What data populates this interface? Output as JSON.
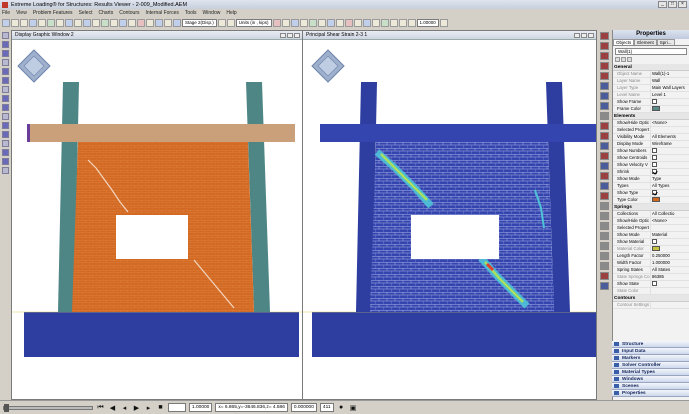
{
  "window": {
    "title": "Extreme Loading® for Structures: Results Viewer - 2-009_Modified.AEM",
    "minimize": "_",
    "maximize": "□",
    "close": "×"
  },
  "menu": [
    "File",
    "View",
    "Problem Features",
    "Select",
    "Charts",
    "Contours",
    "Internal Forces",
    "Tools",
    "Window",
    "Help"
  ],
  "toolbar": {
    "stage": "Stage 2(Disp.)",
    "units": "Units (in , kips)",
    "scale": "1.00000"
  },
  "windows": [
    {
      "title": "Display Graphic Window 2"
    },
    {
      "title": "Principal Shear Strain 2-3 1"
    }
  ],
  "properties": {
    "title": "Properties",
    "tabs": [
      "Objects",
      "Element",
      "Spri..."
    ],
    "selected": "Wall(1)",
    "groups": [
      {
        "name": "General",
        "rows": [
          {
            "n": "Object Name",
            "v": "Wall(1)-1",
            "grey": true
          },
          {
            "n": "Layer Name",
            "v": "Wall",
            "grey": true
          },
          {
            "n": "Layer Type",
            "v": "Main Wall Layers",
            "grey": true
          },
          {
            "n": "Level Name",
            "v": "Level 1",
            "grey": true
          },
          {
            "n": "Show Frame",
            "v": "",
            "cb": "off"
          },
          {
            "n": "Frame Color",
            "v": "",
            "color": "#5b8a8a"
          }
        ]
      },
      {
        "name": "Elements",
        "rows": [
          {
            "n": "Show/Hide Optic",
            "v": "<None>"
          },
          {
            "n": "Selected Propert",
            "v": ""
          },
          {
            "n": "Visibility Mode",
            "v": "All Elements"
          },
          {
            "n": "Display Mode",
            "v": "Wireframe"
          },
          {
            "n": "Show Numbers",
            "v": "",
            "cb": "off"
          },
          {
            "n": "Show Centroids",
            "v": "",
            "cb": "off"
          },
          {
            "n": "Show Velocity V",
            "v": "",
            "cb": "off"
          },
          {
            "n": "Shrink",
            "v": "",
            "cb": "on"
          },
          {
            "n": "Show Mode",
            "v": "Type"
          },
          {
            "n": "Types",
            "v": "All Types"
          },
          {
            "n": "Show Type",
            "v": "",
            "cb": "on"
          },
          {
            "n": "Type Color",
            "v": "",
            "color": "#d2691e"
          }
        ]
      },
      {
        "name": "Springs",
        "rows": [
          {
            "n": "Collections",
            "v": "All Collectio"
          },
          {
            "n": "Show/Hide Optic",
            "v": "<None>"
          },
          {
            "n": "Selected Propert",
            "v": ""
          },
          {
            "n": "Show Mode",
            "v": "Material"
          },
          {
            "n": "Show Material",
            "v": "",
            "cb": "off"
          },
          {
            "n": "Material Color",
            "v": "",
            "color": "#c8c040",
            "grey": true
          },
          {
            "n": "Length Factor",
            "v": "0.250000"
          },
          {
            "n": "Width Factor",
            "v": "1.000000"
          },
          {
            "n": "Spring States",
            "v": "All States"
          },
          {
            "n": "State Springs Co",
            "v": "86385",
            "grey": true
          },
          {
            "n": "Show State",
            "v": "",
            "cb": "off"
          },
          {
            "n": "State Color",
            "v": "",
            "grey": true
          }
        ]
      },
      {
        "name": "Contours",
        "rows": [
          {
            "n": "Contour Settings",
            "v": "",
            "grey": true
          }
        ]
      }
    ]
  },
  "panels": [
    "Structure",
    "Input Data",
    "Markers",
    "Solver Controller",
    "Material Types",
    "Windows",
    "Scenes",
    "Properties"
  ],
  "statusbar": {
    "time": "1.00000",
    "coords": "x= 6.865,y=-3646.836,z= 4.586",
    "value": "0.000000",
    "frame": "411"
  },
  "colors": {
    "wall_orange": "#d26a24",
    "column_teal": "#4d8684",
    "beam_tan": "#caa07a",
    "strain_blue": "#3545b0",
    "foundation_blue": "#2d3da0"
  }
}
